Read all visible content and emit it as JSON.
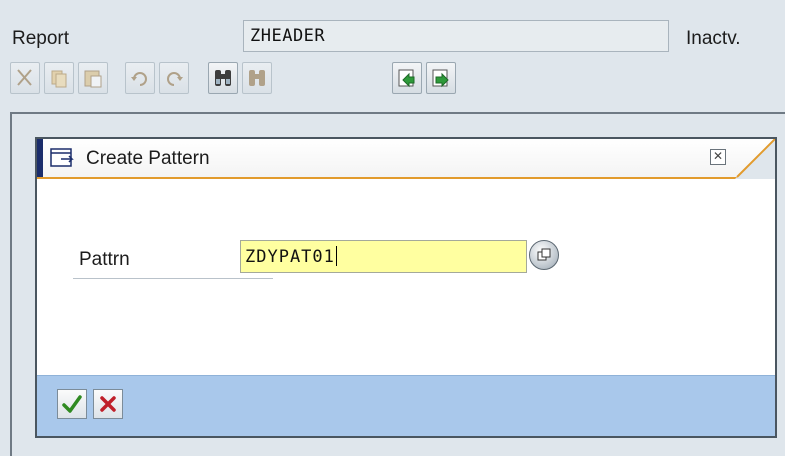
{
  "header": {
    "report_label": "Report",
    "report_value": "ZHEADER",
    "status": "Inactv."
  },
  "toolbar": {
    "buttons": [
      {
        "name": "cut-icon",
        "enabled": false
      },
      {
        "name": "copy-icon",
        "enabled": false
      },
      {
        "name": "paste-icon",
        "enabled": false
      },
      {
        "name": "undo-icon",
        "enabled": false
      },
      {
        "name": "redo-icon",
        "enabled": false
      },
      {
        "name": "find-icon",
        "enabled": true
      },
      {
        "name": "find-next-icon",
        "enabled": false
      },
      {
        "name": "insert-statement-icon",
        "enabled": true
      },
      {
        "name": "pattern-icon",
        "enabled": true
      }
    ]
  },
  "dialog": {
    "title": "Create Pattern",
    "field_label": "Pattrn",
    "field_value": "ZDYPAT01",
    "buttons": {
      "ok": "continue-check-icon",
      "cancel": "cancel-x-icon"
    }
  },
  "colors": {
    "input_required_bg": "#ffffa0",
    "title_underline": "#e29b2d",
    "footer_bg": "#a9c8eb",
    "title_accent": "#1b2d6b"
  }
}
